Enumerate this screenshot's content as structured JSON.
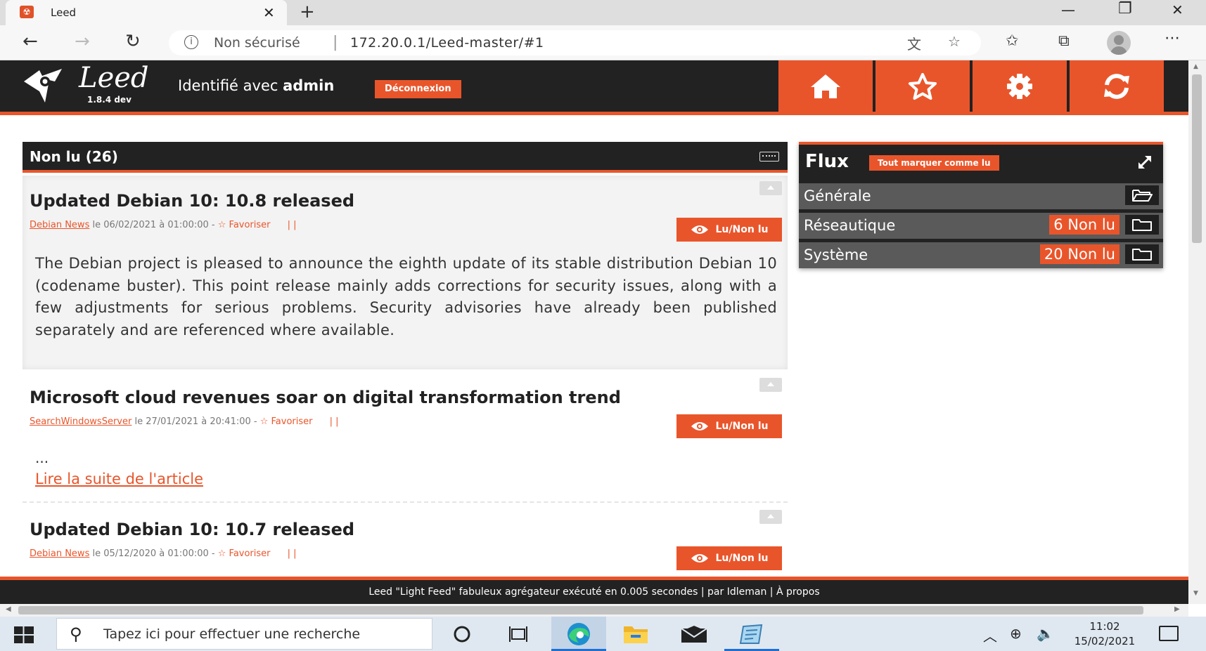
{
  "browser": {
    "tab_title": "Leed",
    "tab_close": "✕",
    "new_tab": "+",
    "security_label": "Non sécurisé",
    "url": "172.20.0.1/Leed-master/#1",
    "window_minimize": "—",
    "window_restore": "❐",
    "window_close": "✕"
  },
  "leed": {
    "logo_name": "Leed",
    "version": "1.8.4 dev",
    "identity_prefix": "Identifié avec",
    "identity_user": "admin",
    "logout_label": "Déconnexion",
    "accent_color": "#e9552b",
    "menu_icons": [
      "home-icon",
      "star-icon",
      "gear-icon",
      "refresh-icon"
    ]
  },
  "articles": {
    "header": "Non lu (26)",
    "items": [
      {
        "title": "Updated Debian 10: 10.8 released",
        "source": "Debian News",
        "date": "le 06/02/2021 à 01:00:00 -",
        "favorite": "☆ Favoriser",
        "bars": "| |",
        "read_label": "Lu/Non lu",
        "body": "The Debian project is pleased to announce the eighth update of its stable distribution Debian 10 (codename buster). This point release mainly adds corrections for security issues, along with a few adjustments for serious problems. Security advisories have already been published separately and are referenced where available."
      },
      {
        "title": "Microsoft cloud revenues soar on digital transformation trend",
        "source": "SearchWindowsServer",
        "date": "le 27/01/2021 à 20:41:00 -",
        "favorite": "☆ Favoriser",
        "bars": "| |",
        "read_label": "Lu/Non lu",
        "ellipsis": "...",
        "more_link": "Lire la suite de l'article"
      },
      {
        "title": "Updated Debian 10: 10.7 released",
        "source": "Debian News",
        "date": "le 05/12/2020 à 01:00:00 -",
        "favorite": "☆ Favoriser",
        "bars": "| |",
        "read_label": "Lu/Non lu"
      }
    ]
  },
  "flux": {
    "title": "Flux",
    "mark_all_label": "Tout marquer comme lu",
    "folders": [
      {
        "name": "Générale",
        "count": null,
        "open": true
      },
      {
        "name": "Réseautique",
        "count": "6 Non lu",
        "open": false
      },
      {
        "name": "Système",
        "count": "20 Non lu",
        "open": false
      }
    ]
  },
  "footer": {
    "text": "Leed \"Light Feed\" fabuleux agrégateur exécuté en 0.005 secondes | par Idleman | À propos"
  },
  "taskbar": {
    "search_placeholder": "Tapez ici pour effectuer une recherche",
    "time": "11:02",
    "date": "15/02/2021"
  }
}
